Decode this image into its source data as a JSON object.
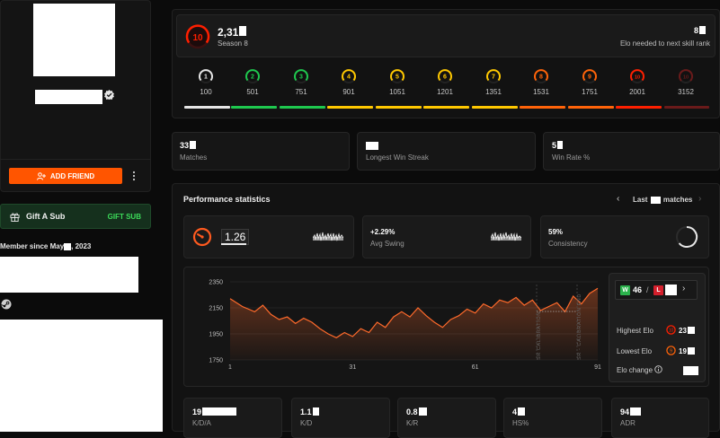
{
  "profile": {
    "add_friend_label": "ADD FRIEND",
    "more_icon": "vertical-dots-icon",
    "gift_label": "Gift A Sub",
    "gift_button_label": "GIFT SUB",
    "member_since": "Member since May",
    "member_year": ", 2023"
  },
  "elo": {
    "level": "10",
    "value": "2,31",
    "season": "Season 8",
    "needed_value": "8",
    "needed_label": "Elo needed to next skill rank"
  },
  "ranks": [
    {
      "level": "1",
      "elo": "100",
      "color": "#e6e6e6"
    },
    {
      "level": "2",
      "elo": "501",
      "color": "#1ec84e"
    },
    {
      "level": "3",
      "elo": "751",
      "color": "#1ec84e"
    },
    {
      "level": "4",
      "elo": "901",
      "color": "#ffc800"
    },
    {
      "level": "5",
      "elo": "1051",
      "color": "#ffc800"
    },
    {
      "level": "6",
      "elo": "1201",
      "color": "#ffc800"
    },
    {
      "level": "7",
      "elo": "1351",
      "color": "#ffc800"
    },
    {
      "level": "8",
      "elo": "1531",
      "color": "#ff6309"
    },
    {
      "level": "9",
      "elo": "1751",
      "color": "#ff6309"
    },
    {
      "level": "10",
      "elo": "2001",
      "color": "#fe1f00"
    },
    {
      "level": "10",
      "elo": "3152",
      "color": "#6a1a1a"
    }
  ],
  "summary": {
    "matches_value": "33",
    "matches_label": "Matches",
    "streak_label": "Longest Win Streak",
    "winrate_value": "5",
    "winrate_label": "Win Rate %"
  },
  "performance": {
    "title": "Performance statistics",
    "last_label": "Last",
    "matches_label": "matches",
    "rating_value": "1.26",
    "avg_swing_value": "+2.29%",
    "avg_swing_label": "Avg Swing",
    "consistency_value": "59%",
    "consistency_label": "Consistency"
  },
  "chart_data": {
    "type": "area",
    "x_ticks": [
      "1",
      "31",
      "61",
      "91"
    ],
    "y_ticks": [
      "2350",
      "2150",
      "1950",
      "1750"
    ],
    "ylim": [
      1750,
      2350
    ],
    "xlim": [
      1,
      91
    ],
    "annotations": [
      "SR CALIBRATION",
      "SR - CALIBRATION END"
    ],
    "x": [
      1,
      4,
      7,
      9,
      11,
      13,
      15,
      17,
      19,
      21,
      23,
      25,
      27,
      29,
      31,
      33,
      35,
      37,
      39,
      41,
      43,
      45,
      47,
      49,
      51,
      53,
      55,
      57,
      59,
      61,
      63,
      65,
      67,
      69,
      71,
      73,
      75,
      77,
      79,
      81,
      83,
      85,
      87,
      89,
      91
    ],
    "values": [
      2220,
      2160,
      2120,
      2170,
      2100,
      2060,
      2080,
      2030,
      2070,
      2040,
      1990,
      1950,
      1920,
      1960,
      1930,
      1990,
      1960,
      2040,
      2000,
      2080,
      2120,
      2080,
      2150,
      2090,
      2040,
      2000,
      2060,
      2090,
      2140,
      2110,
      2180,
      2150,
      2210,
      2190,
      2230,
      2170,
      2210,
      2130,
      2160,
      2190,
      2120,
      2240,
      2180,
      2260,
      2300
    ],
    "color": "#ff6a2b"
  },
  "record": {
    "wins_badge": "W",
    "wins": "46",
    "separator": "/",
    "loss_badge": "L",
    "highest_label": "Highest Elo",
    "highest_value": "23",
    "lowest_label": "Lowest Elo",
    "lowest_value": "19",
    "change_label": "Elo change"
  },
  "stats": [
    {
      "value": "19",
      "label": "K/D/A"
    },
    {
      "value": "1.1",
      "label": "K/D"
    },
    {
      "value": "0.8",
      "label": "K/R"
    },
    {
      "value": "4",
      "label": "HS%"
    },
    {
      "value": "94",
      "label": "ADR"
    }
  ]
}
